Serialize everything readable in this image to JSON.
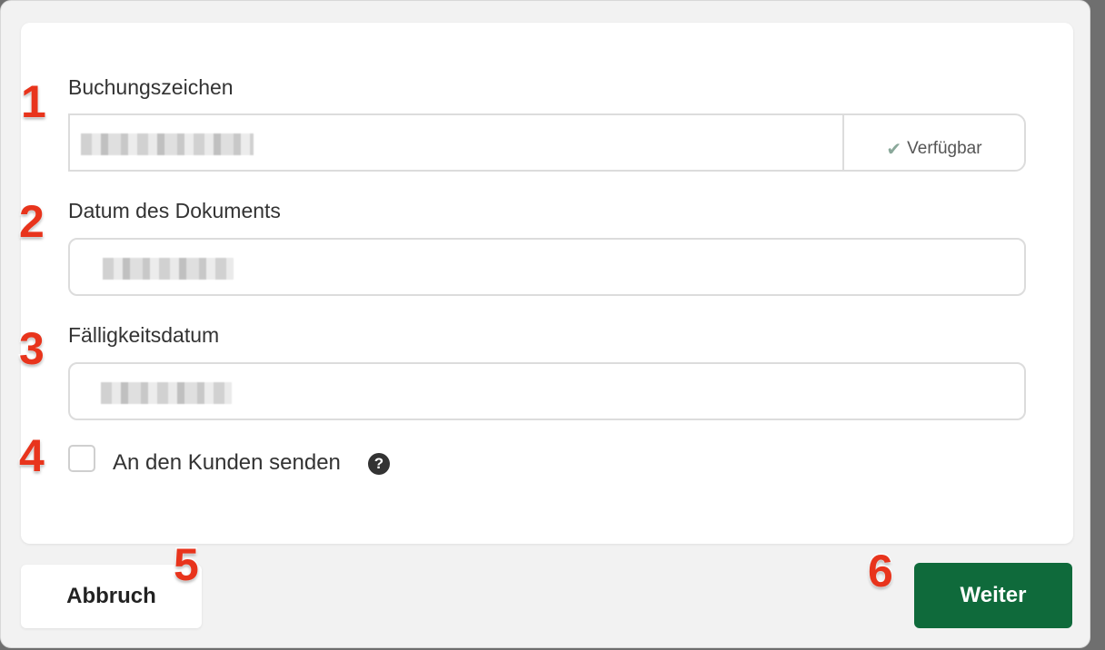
{
  "fields": {
    "booking_ref": {
      "label": "Buchungszeichen",
      "value": "",
      "availability": "Verfügbar"
    },
    "document_date": {
      "label": "Datum des Dokuments",
      "value": ""
    },
    "due_date": {
      "label": "Fälligkeitsdatum",
      "value": ""
    }
  },
  "send_to_customer": {
    "label": "An den Kunden senden",
    "checked": false,
    "help_icon": "question-circle-icon"
  },
  "buttons": {
    "cancel": "Abbruch",
    "next": "Weiter"
  },
  "annotations": [
    "1",
    "2",
    "3",
    "4",
    "5",
    "6"
  ],
  "colors": {
    "primary_button": "#0f6a3b",
    "annotation": "#e8341c",
    "check": "#8aa89a"
  }
}
